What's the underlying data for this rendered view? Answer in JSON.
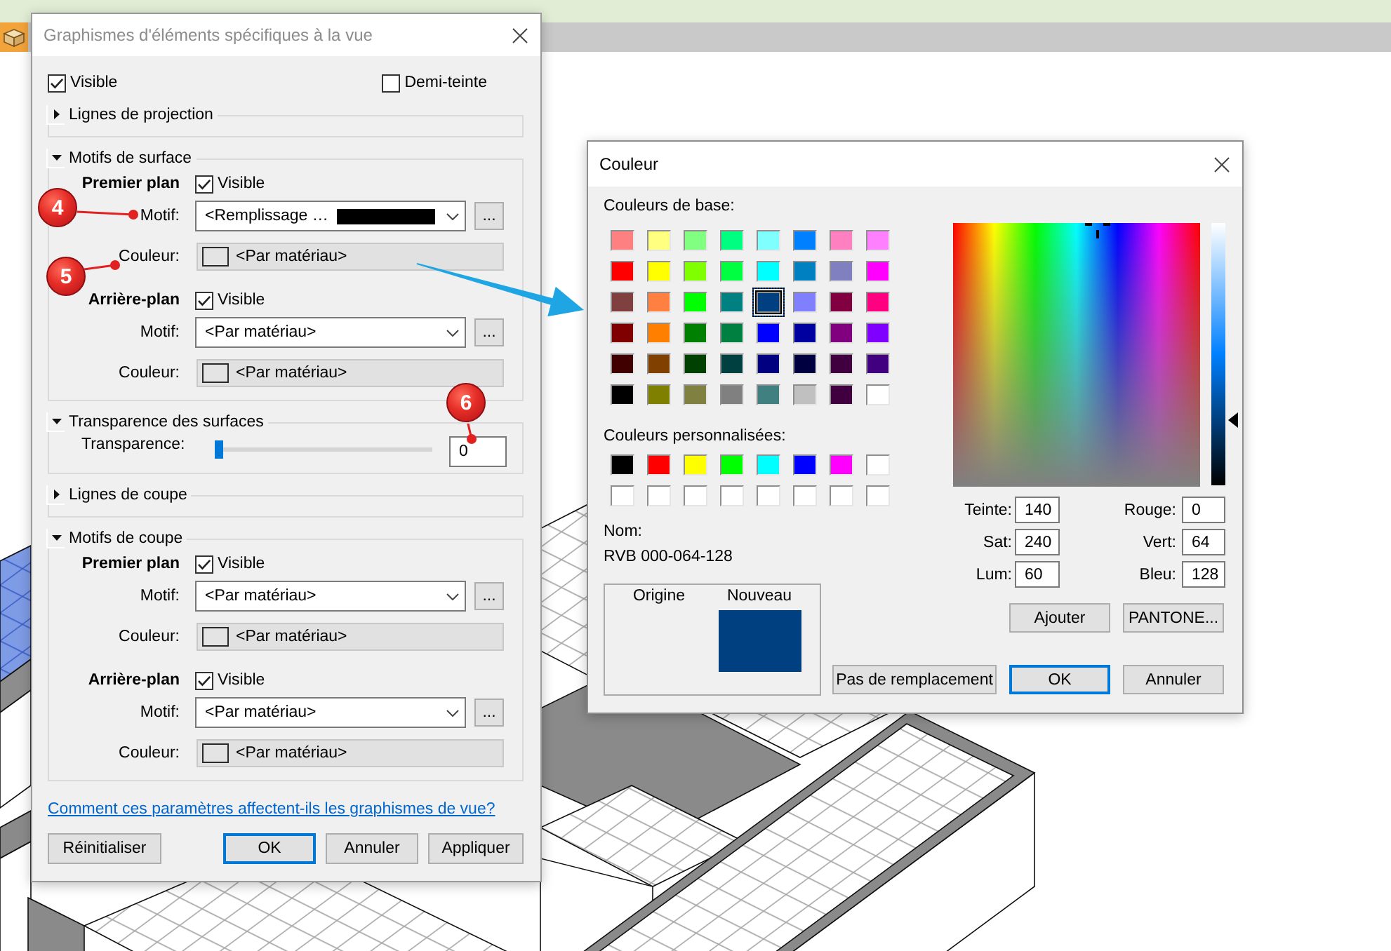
{
  "view_dialog": {
    "title": "Graphismes d'éléments spécifiques à la vue",
    "visible": {
      "label": "Visible",
      "checked": true
    },
    "halftone": {
      "label": "Demi-teinte",
      "checked": false
    },
    "sections": [
      {
        "kind": "lines",
        "title": "Lignes de projection",
        "expanded": false
      },
      {
        "kind": "patterns",
        "title": "Motifs de surface",
        "expanded": true,
        "planes": [
          {
            "title": "Premier plan",
            "visible": {
              "label": "Visible",
              "checked": true
            },
            "pattern": {
              "label": "Motif:",
              "value": "<Remplissage …",
              "color": "#000000"
            },
            "browse": "...",
            "fill": {
              "label": "Couleur:",
              "value": "<Par matériau>"
            }
          },
          {
            "title": "Arrière-plan",
            "visible": {
              "label": "Visible",
              "checked": true
            },
            "pattern": {
              "label": "Motif:",
              "value": "<Par matériau>"
            },
            "browse": "...",
            "fill": {
              "label": "Couleur:",
              "value": "<Par matériau>"
            }
          }
        ]
      },
      {
        "kind": "transparency",
        "title": "Transparence des surfaces",
        "expanded": true,
        "label": "Transparence:",
        "level": 0,
        "value": "0"
      },
      {
        "kind": "lines",
        "title": "Lignes de coupe",
        "expanded": false
      },
      {
        "kind": "patterns",
        "title": "Motifs de coupe",
        "expanded": true,
        "planes": [
          {
            "title": "Premier plan",
            "visible": {
              "label": "Visible",
              "checked": true
            },
            "pattern": {
              "label": "Motif:",
              "value": "<Par matériau>"
            },
            "browse": "...",
            "fill": {
              "label": "Couleur:",
              "value": "<Par matériau>"
            }
          },
          {
            "title": "Arrière-plan",
            "visible": {
              "label": "Visible",
              "checked": true
            },
            "pattern": {
              "label": "Motif:",
              "value": "<Par matériau>"
            },
            "browse": "...",
            "fill": {
              "label": "Couleur:",
              "value": "<Par matériau>"
            }
          }
        ]
      }
    ],
    "help_link": "Comment ces paramètres affectent-ils les graphismes de vue?",
    "buttons": [
      {
        "label": "Réinitialiser",
        "default": false
      },
      {
        "label": "OK",
        "default": true
      },
      {
        "label": "Annuler",
        "default": false
      },
      {
        "label": "Appliquer",
        "default": false
      }
    ]
  },
  "color_dialog": {
    "title": "Couleur",
    "basic_label": "Couleurs de base:",
    "basic_colors": [
      {
        "color": "#ff8080",
        "selected": false
      },
      {
        "color": "#ffff80",
        "selected": false
      },
      {
        "color": "#80ff80",
        "selected": false
      },
      {
        "color": "#00ff80",
        "selected": false
      },
      {
        "color": "#80ffff",
        "selected": false
      },
      {
        "color": "#0080ff",
        "selected": false
      },
      {
        "color": "#ff80c0",
        "selected": false
      },
      {
        "color": "#ff80ff",
        "selected": false
      },
      {
        "color": "#ff0000",
        "selected": false
      },
      {
        "color": "#ffff00",
        "selected": false
      },
      {
        "color": "#80ff00",
        "selected": false
      },
      {
        "color": "#00ff40",
        "selected": false
      },
      {
        "color": "#00ffff",
        "selected": false
      },
      {
        "color": "#0080c0",
        "selected": false
      },
      {
        "color": "#8080c0",
        "selected": false
      },
      {
        "color": "#ff00ff",
        "selected": false
      },
      {
        "color": "#804040",
        "selected": false
      },
      {
        "color": "#ff8040",
        "selected": false
      },
      {
        "color": "#00ff00",
        "selected": false
      },
      {
        "color": "#008080",
        "selected": false
      },
      {
        "color": "#004080",
        "selected": true
      },
      {
        "color": "#8080ff",
        "selected": false
      },
      {
        "color": "#800040",
        "selected": false
      },
      {
        "color": "#ff0080",
        "selected": false
      },
      {
        "color": "#800000",
        "selected": false
      },
      {
        "color": "#ff8000",
        "selected": false
      },
      {
        "color": "#008000",
        "selected": false
      },
      {
        "color": "#008040",
        "selected": false
      },
      {
        "color": "#0000ff",
        "selected": false
      },
      {
        "color": "#0000a0",
        "selected": false
      },
      {
        "color": "#800080",
        "selected": false
      },
      {
        "color": "#8000ff",
        "selected": false
      },
      {
        "color": "#400000",
        "selected": false
      },
      {
        "color": "#804000",
        "selected": false
      },
      {
        "color": "#004000",
        "selected": false
      },
      {
        "color": "#004040",
        "selected": false
      },
      {
        "color": "#000080",
        "selected": false
      },
      {
        "color": "#000040",
        "selected": false
      },
      {
        "color": "#400040",
        "selected": false
      },
      {
        "color": "#400080",
        "selected": false
      },
      {
        "color": "#000000",
        "selected": false
      },
      {
        "color": "#808000",
        "selected": false
      },
      {
        "color": "#808040",
        "selected": false
      },
      {
        "color": "#808080",
        "selected": false
      },
      {
        "color": "#408080",
        "selected": false
      },
      {
        "color": "#c0c0c0",
        "selected": false
      },
      {
        "color": "#400040",
        "selected": false
      },
      {
        "color": "#ffffff",
        "selected": false
      }
    ],
    "custom_label": "Couleurs personnalisées:",
    "custom_colors": [
      {
        "color": "#000000",
        "selected": false
      },
      {
        "color": "#ff0000",
        "selected": false
      },
      {
        "color": "#ffff00",
        "selected": false
      },
      {
        "color": "#00ff00",
        "selected": false
      },
      {
        "color": "#00ffff",
        "selected": false
      },
      {
        "color": "#0000ff",
        "selected": false
      },
      {
        "color": "#ff00ff",
        "selected": false
      },
      {
        "color": "#ffffff",
        "selected": false
      },
      {
        "color": "#ffffff",
        "selected": false
      },
      {
        "color": "#ffffff",
        "selected": false
      },
      {
        "color": "#ffffff",
        "selected": false
      },
      {
        "color": "#ffffff",
        "selected": false
      },
      {
        "color": "#ffffff",
        "selected": false
      },
      {
        "color": "#ffffff",
        "selected": false
      },
      {
        "color": "#ffffff",
        "selected": false
      },
      {
        "color": "#ffffff",
        "selected": false
      }
    ],
    "name_label": "Nom:",
    "name_value": "RVB 000-064-128",
    "preview": {
      "origin": {
        "label": "Origine"
      },
      "new": {
        "label": "Nouveau",
        "color": "#004080"
      }
    },
    "luminance": {
      "level": 0.25
    },
    "fields": [
      {
        "label": "Teinte:",
        "value": "140"
      },
      {
        "label": "Sat:",
        "value": "240"
      },
      {
        "label": "Lum:",
        "value": "60"
      },
      {
        "label": "Rouge:",
        "value": "0"
      },
      {
        "label": "Vert:",
        "value": "64"
      },
      {
        "label": "Bleu:",
        "value": "128"
      }
    ],
    "custom_buttons": [
      {
        "label": "Ajouter",
        "default": false
      },
      {
        "label": "PANTONE...",
        "default": false
      }
    ],
    "buttons": [
      {
        "label": "Pas de remplacement",
        "default": false
      },
      {
        "label": "OK",
        "default": true
      },
      {
        "label": "Annuler",
        "default": false
      }
    ]
  },
  "callouts": [
    {
      "label": "4"
    },
    {
      "label": "5"
    },
    {
      "label": "6"
    }
  ]
}
